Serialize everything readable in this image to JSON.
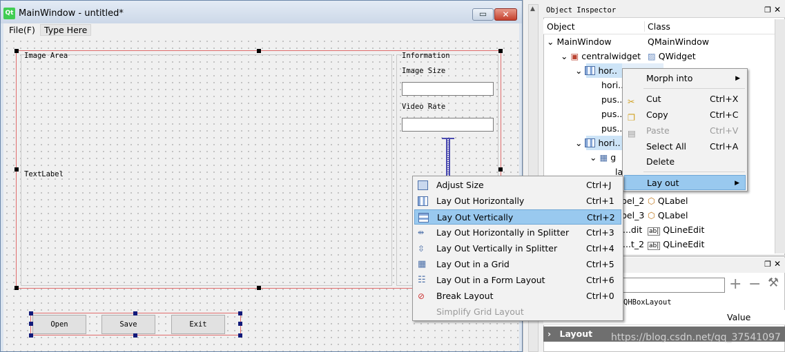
{
  "window": {
    "title": "MainWindow - untitled*",
    "min_glyph": "▭",
    "close_glyph": "✕",
    "logo": "Qt"
  },
  "menubar": {
    "file": "File(F)",
    "type_here": "Type Here"
  },
  "form": {
    "image_area_title": "Image Area",
    "information_title": "Information",
    "image_size_label": "Image Size",
    "video_rate_label": "Video Rate",
    "text_label": "TextLabel",
    "buttons": {
      "open": "Open",
      "save": "Save",
      "exit": "Exit"
    }
  },
  "inspector": {
    "title": "Object Inspector",
    "headers": {
      "object": "Object",
      "class": "Class"
    },
    "rows": [
      {
        "object": "MainWindow",
        "class": "QMainWindow"
      },
      {
        "object": "centralwidget",
        "class": "QWidget"
      },
      {
        "object": "hor..",
        "class": ""
      },
      {
        "object": "hori..",
        "class": ""
      },
      {
        "object": "pus..",
        "class": ""
      },
      {
        "object": "pus..",
        "class": ""
      },
      {
        "object": "pus..",
        "class": ""
      },
      {
        "object": "hori..",
        "class": ""
      },
      {
        "object": "g",
        "class": ""
      },
      {
        "object": "la",
        "class": ""
      },
      {
        "object": "bel_2",
        "class": "QLabel"
      },
      {
        "object": "bel_3",
        "class": "QLabel"
      },
      {
        "object": "...dit",
        "class": "QLineEdit"
      },
      {
        "object": "...t_2",
        "class": "QLineEdit"
      }
    ]
  },
  "property_editor": {
    "class_name": "QHBoxLayout",
    "value_header": "Value",
    "layout_section": "Layout"
  },
  "context_menu_main": [
    {
      "label": "Morph into",
      "shortcut": "",
      "submenu": true
    },
    {
      "label": "Cut",
      "shortcut": "Ctrl+X",
      "icon": "scissors-icon"
    },
    {
      "label": "Copy",
      "shortcut": "Ctrl+C",
      "icon": "copy-icon"
    },
    {
      "label": "Paste",
      "shortcut": "Ctrl+V",
      "icon": "paste-icon",
      "disabled": true
    },
    {
      "label": "Select All",
      "shortcut": "Ctrl+A"
    },
    {
      "label": "Delete",
      "shortcut": ""
    },
    {
      "label": "Lay out",
      "shortcut": "",
      "submenu": true,
      "highlighted": true
    }
  ],
  "context_menu_layout": [
    {
      "label": "Adjust Size",
      "shortcut": "Ctrl+J",
      "icon": "adjust-size-icon"
    },
    {
      "label": "Lay Out Horizontally",
      "shortcut": "Ctrl+1",
      "icon": "layout-horizontal-icon"
    },
    {
      "label": "Lay Out Vertically",
      "shortcut": "Ctrl+2",
      "icon": "layout-vertical-icon",
      "highlighted": true
    },
    {
      "label": "Lay Out Horizontally in Splitter",
      "shortcut": "Ctrl+3",
      "icon": "hsplitter-icon"
    },
    {
      "label": "Lay Out Vertically in Splitter",
      "shortcut": "Ctrl+4",
      "icon": "vsplitter-icon"
    },
    {
      "label": "Lay Out in a Grid",
      "shortcut": "Ctrl+5",
      "icon": "grid-icon"
    },
    {
      "label": "Lay Out in a Form Layout",
      "shortcut": "Ctrl+6",
      "icon": "form-layout-icon"
    },
    {
      "label": "Break Layout",
      "shortcut": "Ctrl+0",
      "icon": "break-layout-icon"
    },
    {
      "label": "Simplify Grid Layout",
      "shortcut": "",
      "disabled": true
    }
  ],
  "watermark": "https://blog.csdn.net/qq_37541097",
  "colors": {
    "selection": "#99c9ef",
    "form_border": "#e06a6a",
    "handle": "#000000"
  }
}
